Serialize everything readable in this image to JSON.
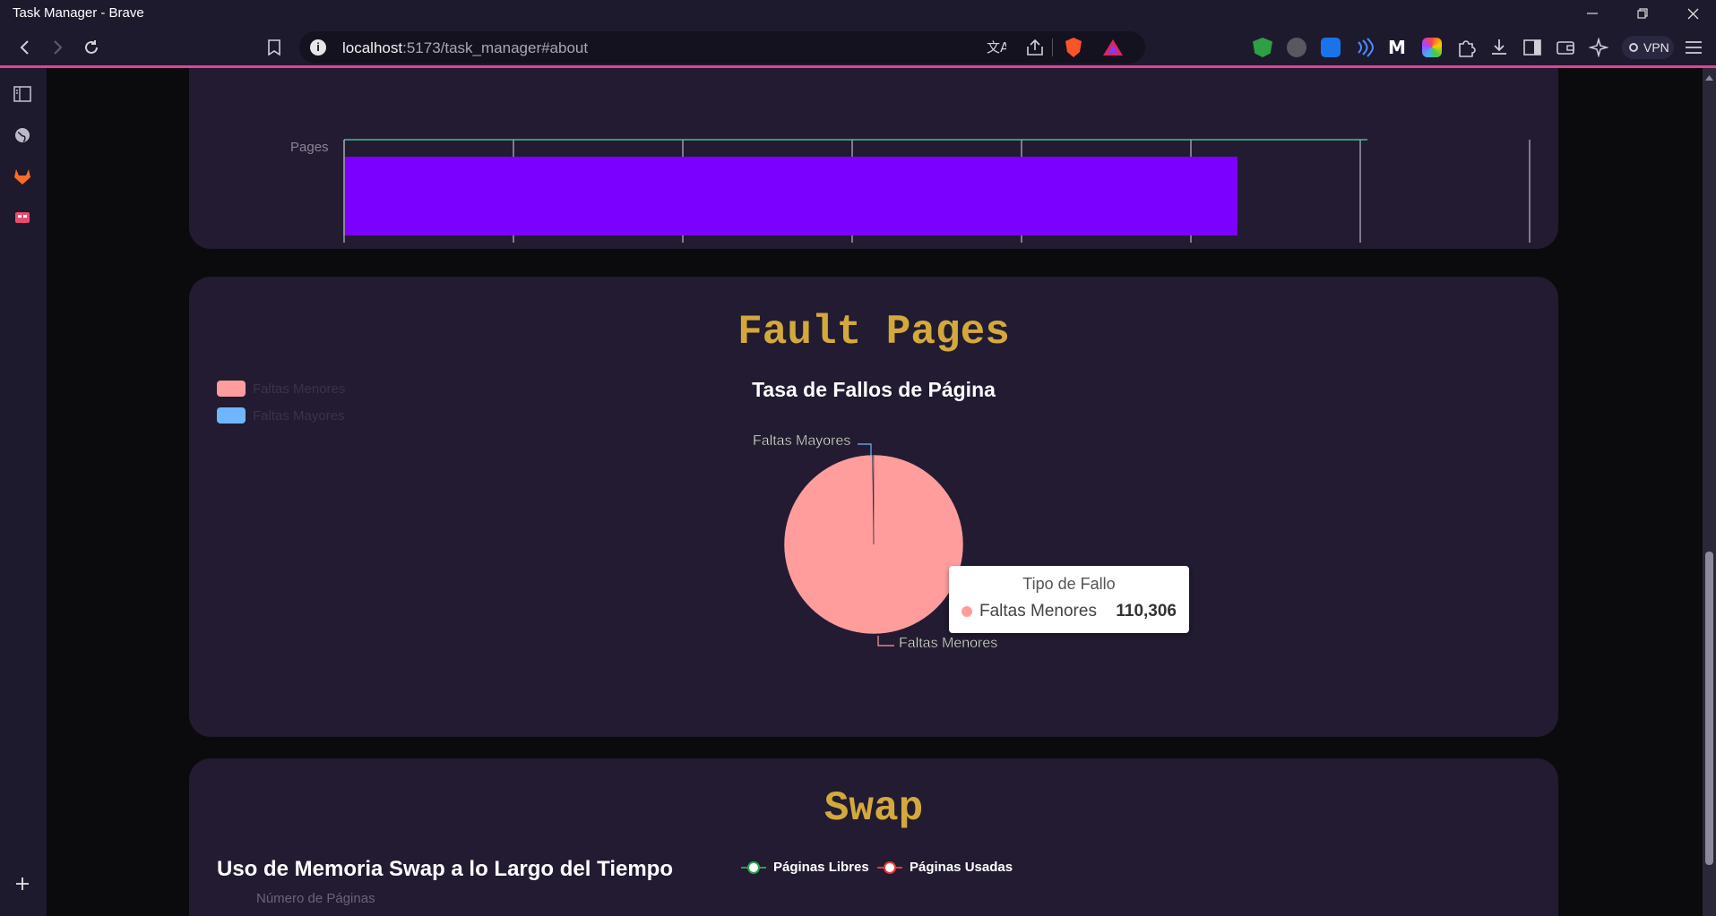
{
  "window": {
    "title": "Task Manager - Brave"
  },
  "toolbar": {
    "url_host": "localhost",
    "url_rest": ":5173/task_manager#about",
    "vpn_label": "VPN"
  },
  "bar_chart": {
    "y_label": "Pages",
    "ticks": [
      "0",
      "100,000",
      "200,000",
      "300,000",
      "400,000",
      "500,000",
      "600,000",
      "700,000"
    ]
  },
  "fault_section": {
    "title": "Fault Pages",
    "chart_title": "Tasa de Fallos de Página",
    "legend": [
      {
        "label": "Faltas Menores",
        "color": "#ff9d9d"
      },
      {
        "label": "Faltas Mayores",
        "color": "#6fb6ff"
      }
    ],
    "pie_label_major": "Faltas Mayores",
    "pie_label_minor": "Faltas Menores",
    "tooltip": {
      "title": "Tipo de Fallo",
      "label": "Faltas Menores",
      "value": "110,306"
    }
  },
  "swap_section": {
    "title": "Swap",
    "chart_title": "Uso de Memoria Swap a lo Largo del Tiempo",
    "legend_free": "Páginas Libres",
    "legend_used": "Páginas Usadas",
    "y_label": "Número de Páginas"
  },
  "chart_data": [
    {
      "type": "bar",
      "orientation": "horizontal",
      "categories": [
        ""
      ],
      "values": [
        527000
      ],
      "xlim": [
        0,
        700000
      ],
      "ylabel": "Pages",
      "xticks": [
        0,
        100000,
        200000,
        300000,
        400000,
        500000,
        600000,
        700000
      ]
    },
    {
      "type": "pie",
      "title": "Tasa de Fallos de Página",
      "categories": [
        "Faltas Menores",
        "Faltas Mayores"
      ],
      "values": [
        110306,
        250
      ],
      "colors": [
        "#ff9d9d",
        "#6fb6ff"
      ],
      "legend": "top-left"
    }
  ]
}
